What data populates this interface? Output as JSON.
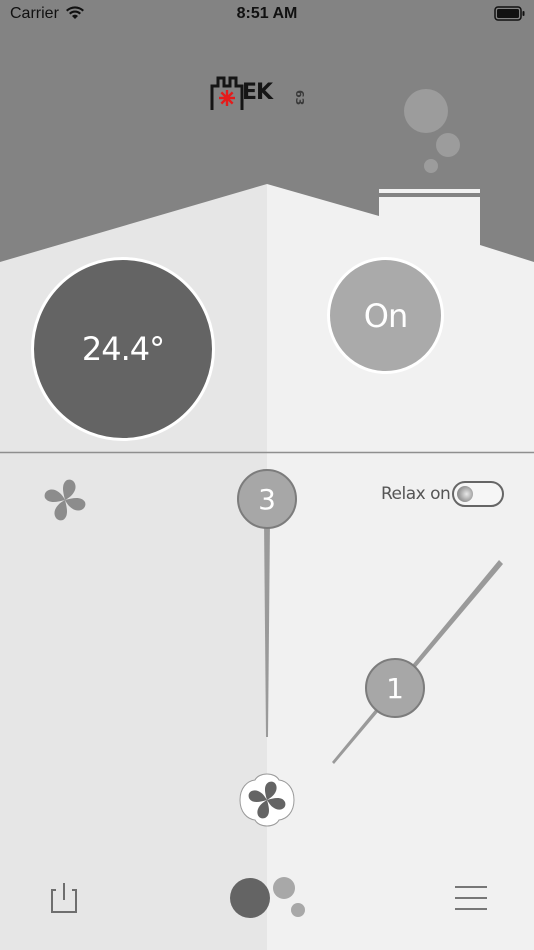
{
  "status_bar": {
    "carrier": "Carrier",
    "time": "8:51 AM"
  },
  "logo": {
    "text": "EK",
    "number": "63"
  },
  "temperature": {
    "value": "24.4°"
  },
  "power_state": {
    "label": "On"
  },
  "fan": {
    "level_max": "3",
    "level_current": "1"
  },
  "relax": {
    "label": "Relax on",
    "enabled": false
  },
  "colors": {
    "header_gray": "#838383",
    "panel_left": "#e6e6e6",
    "panel_right": "#f1f1f1",
    "flame_red": "#e51b1b",
    "dark_circle": "#646464",
    "light_circle": "#aaaaaa"
  },
  "icons": [
    "wifi-icon",
    "battery-icon",
    "fan-icon",
    "power-icon",
    "menu-icon",
    "smoke-icon",
    "flame-icon"
  ]
}
